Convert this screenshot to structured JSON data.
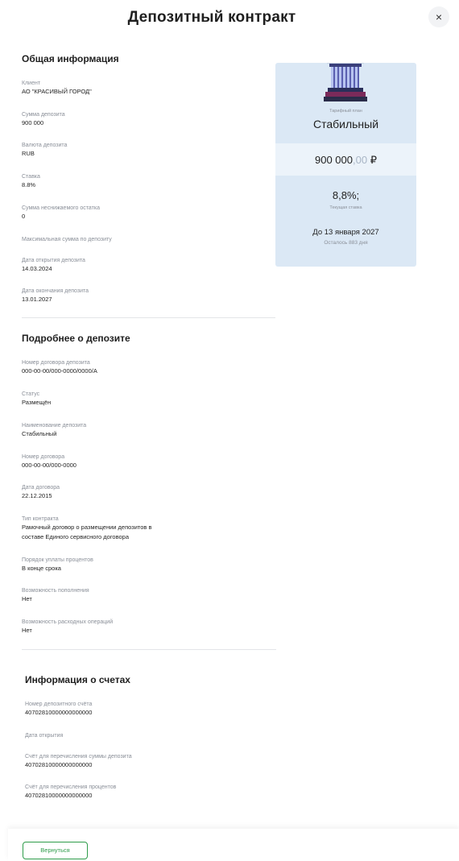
{
  "header": {
    "title": "Депозитный контракт",
    "close_label": "×"
  },
  "general": {
    "title": "Общая информация",
    "fields": [
      {
        "label": "Клиент",
        "value": "АО \"КРАСИВЫЙ ГОРОД\""
      },
      {
        "label": "Сумма депозита",
        "value": "900 000"
      },
      {
        "label": "Валюта депозита",
        "value": "RUB"
      },
      {
        "label": "Ставка",
        "value": "8.8%"
      },
      {
        "label": "Сумма неснижаемого остатка",
        "value": "0"
      },
      {
        "label": "Максимальная сумма по депозиту",
        "value": ""
      },
      {
        "label": "Дата открытия депозита",
        "value": "14.03.2024"
      },
      {
        "label": "Дата окончания депозита",
        "value": "13.01.2027"
      }
    ]
  },
  "details": {
    "title": "Подробнее о депозите",
    "fields": [
      {
        "label": "Номер договора депозита",
        "value": "000-00-00/000-0000/0000/А"
      },
      {
        "label": "Статус",
        "value": "Размещён"
      },
      {
        "label": "Наименование депозита",
        "value": "Стабильный"
      },
      {
        "label": "Номер договора",
        "value": "000-00-00/000-0000"
      },
      {
        "label": "Дата договора",
        "value": "22.12.2015"
      },
      {
        "label": "Тип контракта",
        "value": "Рамочный договор о размещении депозитов в",
        "value2": "составе Единого сервисного договора"
      },
      {
        "label": "Порядок уплаты процентов",
        "value": "В конце срока"
      },
      {
        "label": "Возможность пополнения",
        "value": "Нет"
      },
      {
        "label": "Возможность расходных операций",
        "value": "Нет"
      }
    ]
  },
  "accounts": {
    "title": "Информация о счетах",
    "fields": [
      {
        "label": "Номер депозитного счёта",
        "value": "40702810000000000000"
      },
      {
        "label": "Дата открытия",
        "value": ""
      },
      {
        "label": "Счёт для перечисления суммы депозита",
        "value": "40702810000000000000"
      },
      {
        "label": "Счёт для перечисления процентов",
        "value": "40702810000000000000"
      }
    ]
  },
  "card": {
    "plan_label": "Тарифный план",
    "plan_name": "Стабильный",
    "amount_main": "900 000",
    "amount_kop": ",00",
    "currency": "₽",
    "rate": "8,8%;",
    "rate_label": "Текущая ставка",
    "until": "До 13 января 2027",
    "days_left": "Осталось 883 дня",
    "icon": "pillar-icon",
    "colors": {
      "card_bg": "#dbe8f5",
      "band_bg": "#ecf3fa",
      "accent": "#2e9c4a"
    }
  },
  "footer": {
    "back_label": "Вернуться"
  }
}
